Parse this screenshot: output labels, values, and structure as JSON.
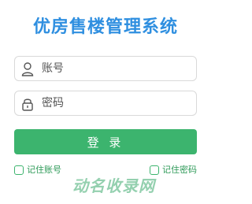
{
  "app": {
    "title": "优房售楼管理系统"
  },
  "login": {
    "account_placeholder": "账号",
    "account_value": "",
    "password_placeholder": "密码",
    "password_value": "",
    "submit_label": "登 录",
    "remember_account_label": "记住账号",
    "remember_account_checked": false,
    "remember_password_label": "记住密码",
    "remember_password_checked": false
  },
  "icons": {
    "account": "user-icon",
    "password": "lock-icon"
  },
  "colors": {
    "title": "#2f8fe0",
    "accent": "#3cb46e",
    "border": "#d9d9d9"
  },
  "watermark": {
    "text": "动名收录网"
  }
}
